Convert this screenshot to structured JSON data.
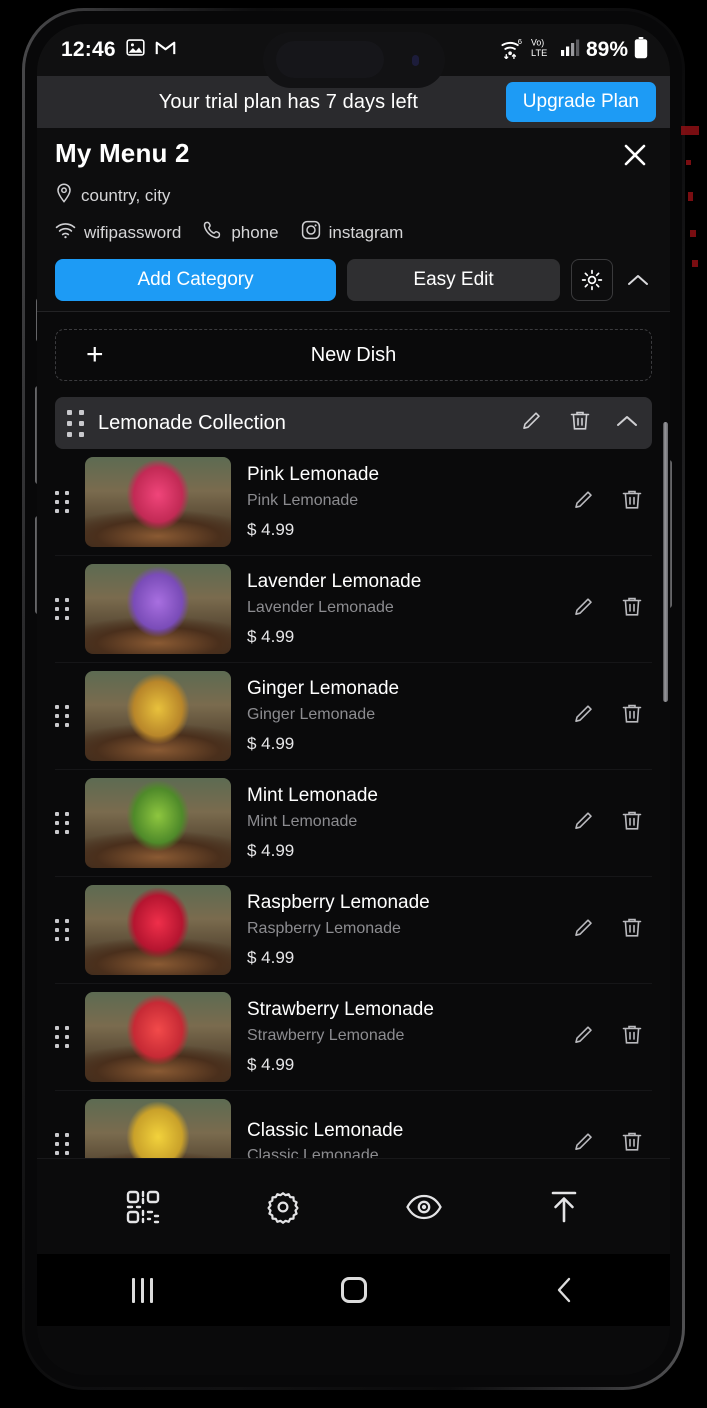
{
  "status_bar": {
    "time": "12:46",
    "icons": [
      "photos-icon",
      "gmail-icon"
    ],
    "network": {
      "wifi": "wifi-6-icon",
      "volte": "VoLTE",
      "lte": "LTE",
      "signal": "signal-bars-icon"
    },
    "battery_percent": "89%"
  },
  "trial_banner": {
    "message": "Your trial plan has 7 days left",
    "upgrade_label": "Upgrade Plan"
  },
  "header": {
    "title": "My Menu 2",
    "location": "country, city",
    "contacts": [
      {
        "icon": "wifi-icon",
        "label": "wifipassword"
      },
      {
        "icon": "phone-icon",
        "label": "phone"
      },
      {
        "icon": "instagram-icon",
        "label": "instagram"
      }
    ],
    "add_category_label": "Add Category",
    "easy_edit_label": "Easy Edit",
    "brightness_icon": "sun-icon",
    "collapse_icon": "chevron-up-icon",
    "close_icon": "close-icon"
  },
  "content": {
    "new_dish_label": "New Dish",
    "new_dish_plus": "+",
    "category": {
      "name": "Lemonade Collection",
      "edit_icon": "pencil-icon",
      "delete_icon": "trash-icon",
      "collapse_icon": "chevron-up-icon"
    },
    "dishes": [
      {
        "title": "Pink Lemonade",
        "description": "Pink Lemonade",
        "price": "$ 4.99",
        "image_colors": [
          "#f0457a",
          "#c22a55",
          "#6b3f2a"
        ]
      },
      {
        "title": "Lavender Lemonade",
        "description": "Lavender Lemonade",
        "price": "$ 4.99",
        "image_colors": [
          "#a86fe0",
          "#7a4cb8",
          "#5b3a6e"
        ]
      },
      {
        "title": "Ginger Lemonade",
        "description": "Ginger Lemonade",
        "price": "$ 4.99",
        "image_colors": [
          "#e8c13c",
          "#b8862a",
          "#6b4a28"
        ]
      },
      {
        "title": "Mint Lemonade",
        "description": "Mint Lemonade",
        "price": "$ 4.99",
        "image_colors": [
          "#8ec63f",
          "#4f8a2a",
          "#35612a"
        ]
      },
      {
        "title": "Raspberry Lemonade",
        "description": "Raspberry Lemonade",
        "price": "$ 4.99",
        "image_colors": [
          "#ef2f4a",
          "#b51530",
          "#6b2a2a"
        ]
      },
      {
        "title": "Strawberry Lemonade",
        "description": "Strawberry Lemonade",
        "price": "$ 4.99",
        "image_colors": [
          "#f24a4a",
          "#c62a35",
          "#7a3a2a"
        ]
      },
      {
        "title": "Classic Lemonade",
        "description": "Classic Lemonade",
        "price": "",
        "image_colors": [
          "#f2d23c",
          "#c9a12a",
          "#6b5a28"
        ]
      }
    ]
  },
  "bottom_toolbar": {
    "buttons": [
      {
        "icon": "qr-code-icon",
        "name": "qr-code-button"
      },
      {
        "icon": "gear-icon",
        "name": "settings-button"
      },
      {
        "icon": "eye-icon",
        "name": "preview-button"
      },
      {
        "icon": "upload-icon",
        "name": "publish-button"
      }
    ]
  },
  "nav_bar": {
    "recents_icon": "recents-icon",
    "home_icon": "home-icon",
    "back_icon": "back-icon"
  },
  "colors": {
    "accent": "#1d9bf5",
    "background": "#0a0a0b",
    "banner": "#2a2a2d",
    "category_row": "#2d2d30",
    "muted_text": "#8c8c90"
  }
}
